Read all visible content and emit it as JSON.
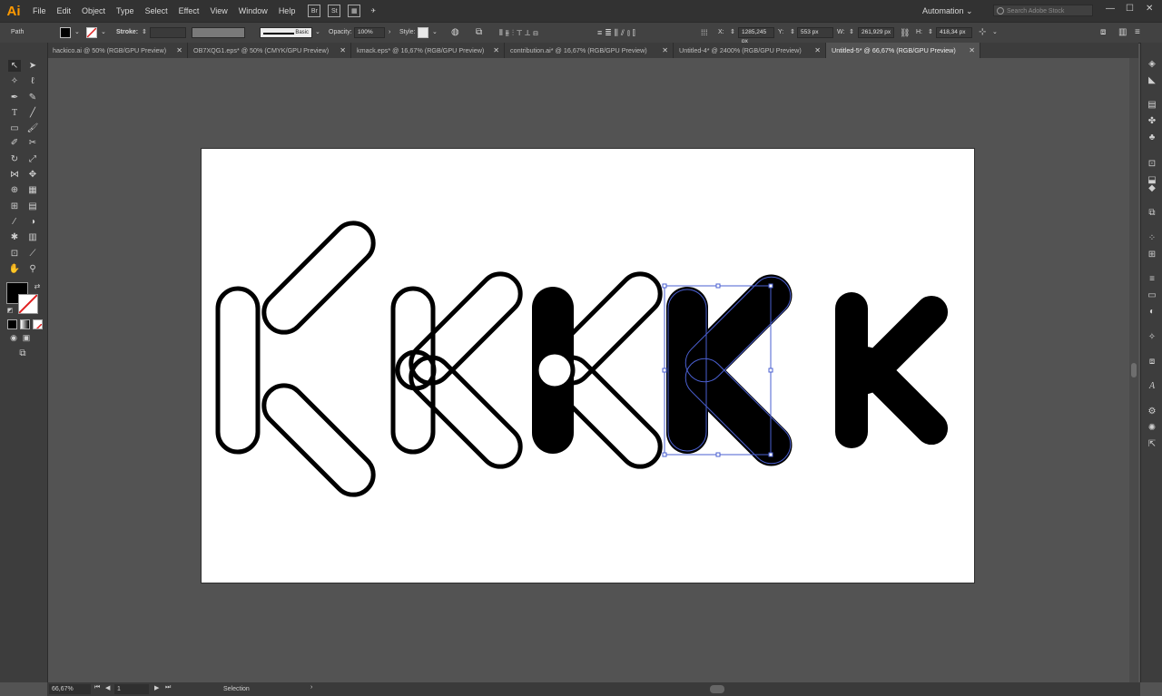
{
  "app": {
    "logo": "Ai"
  },
  "menu": [
    "File",
    "Edit",
    "Object",
    "Type",
    "Select",
    "Effect",
    "View",
    "Window",
    "Help"
  ],
  "workspace": {
    "name": "Automation",
    "search_placeholder": "Search Adobe Stock"
  },
  "control": {
    "object_type": "Path",
    "stroke_label": "Stroke:",
    "brush": "Basic",
    "opacity_label": "Opacity:",
    "opacity": "100%",
    "style_label": "Style:",
    "x_label": "X:",
    "x": "1285,245 px",
    "y_label": "Y:",
    "y": "553 px",
    "w_label": "W:",
    "w": "261,929 px",
    "h_label": "H:",
    "h": "418,34 px"
  },
  "tabs": [
    {
      "label": "hackico.ai @ 50% (RGB/GPU Preview)"
    },
    {
      "label": "OB7XQG1.eps* @ 50% (CMYK/GPU Preview)"
    },
    {
      "label": "kmack.eps* @ 16,67% (RGB/GPU Preview)"
    },
    {
      "label": "contribution.ai* @ 16,67% (RGB/GPU Preview)"
    },
    {
      "label": "Untitled-4* @ 2400% (RGB/GPU Preview)"
    },
    {
      "label": "Untitled-5* @ 66,67% (RGB/GPU Preview)"
    }
  ],
  "status": {
    "zoom": "66,67%",
    "artboard": "1",
    "mode": "Selection"
  },
  "colors": {
    "fill": "#000000",
    "accent": "#ff9a00",
    "selection": "#4a5fd0"
  }
}
